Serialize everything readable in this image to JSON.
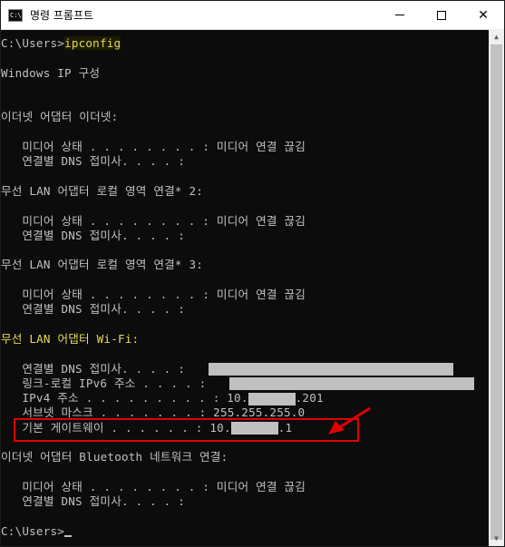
{
  "window": {
    "title": "명령 프롬프트",
    "icon": "cmd-icon",
    "controls": {
      "minimize": "minimize-icon",
      "maximize": "maximize-icon",
      "close": "✕"
    }
  },
  "console": {
    "prompt1": "C:\\Users>",
    "command": "ipconfig",
    "header": "Windows IP 구성",
    "ethernet": {
      "heading": "이더넷 어댑터 이더넷:",
      "media_state_label": "   미디어 상태 . . . . . . . . : ",
      "media_state_value": "미디어 연결 끊김",
      "dns_suffix_label": "   연결별 DNS 접미사. . . . :"
    },
    "wlan2": {
      "heading": "무선 LAN 어댑터 로컬 영역 연결* 2:",
      "media_state_label": "   미디어 상태 . . . . . . . . : ",
      "media_state_value": "미디어 연결 끊김",
      "dns_suffix_label": "   연결별 DNS 접미사. . . . :"
    },
    "wlan3": {
      "heading": "무선 LAN 어댑터 로컬 영역 연결* 3:",
      "media_state_label": "   미디어 상태 . . . . . . . . : ",
      "media_state_value": "미디어 연결 끊김",
      "dns_suffix_label": "   연결별 DNS 접미사. . . . :"
    },
    "wifi": {
      "heading": "무선 LAN 어댑터 Wi-Fi:",
      "dns_suffix_label": "   연결별 DNS 접미사. . . . :",
      "link_local_label": "   링크-로컬 IPv6 주소 . . . . :",
      "ipv4_label": "   IPv4 주소 . . . . . . . . . : ",
      "ipv4_prefix": "10.",
      "ipv4_suffix": ".201",
      "subnet_label": "   서브넷 마스크 . . . . . . . : ",
      "subnet_value": "255.255.255.0",
      "gateway_label": "   기본 게이트웨이 . . . . . . : ",
      "gateway_prefix": "10.",
      "gateway_suffix": ".1"
    },
    "bluetooth": {
      "heading": "이더넷 어댑터 Bluetooth 네트워크 연결:",
      "media_state_label": "   미디어 상태 . . . . . . . . : ",
      "media_state_value": "미디어 연결 끊김",
      "dns_suffix_label": "   연결별 DNS 접미사. . . . :"
    },
    "prompt2": "C:\\Users>"
  },
  "colors": {
    "background": "#0c0c0c",
    "text": "#c0c0c0",
    "highlight": "#e6d85a",
    "annotation": "#e00000"
  }
}
